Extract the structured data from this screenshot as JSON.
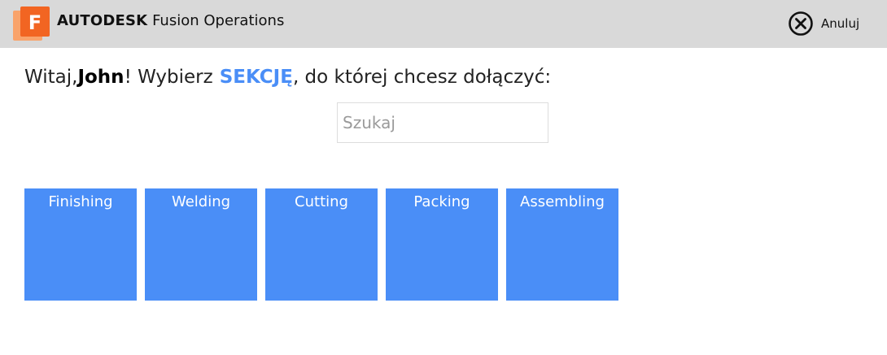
{
  "header": {
    "logo_letter": "F",
    "brand_strong": "AUTODESK",
    "brand_product": "Fusion Operations",
    "cancel_label": "Anuluj",
    "background_color": "#d9d9d9"
  },
  "greeting": {
    "prefix": "Witaj,",
    "user_name": "John",
    "middle": "! Wybierz",
    "section_word": "SEKCJĘ",
    "suffix": ", do której chcesz dołączyć:"
  },
  "search": {
    "placeholder": "Szukaj",
    "value": ""
  },
  "sections": [
    {
      "label": "Finishing"
    },
    {
      "label": "Welding"
    },
    {
      "label": "Cutting"
    },
    {
      "label": "Packing"
    },
    {
      "label": "Assembling"
    }
  ],
  "colors": {
    "accent": "#4a8ef7",
    "logo_orange": "#f26522"
  },
  "icons": {
    "logo": "fusion-logo-icon",
    "cancel": "close-circle-icon"
  }
}
